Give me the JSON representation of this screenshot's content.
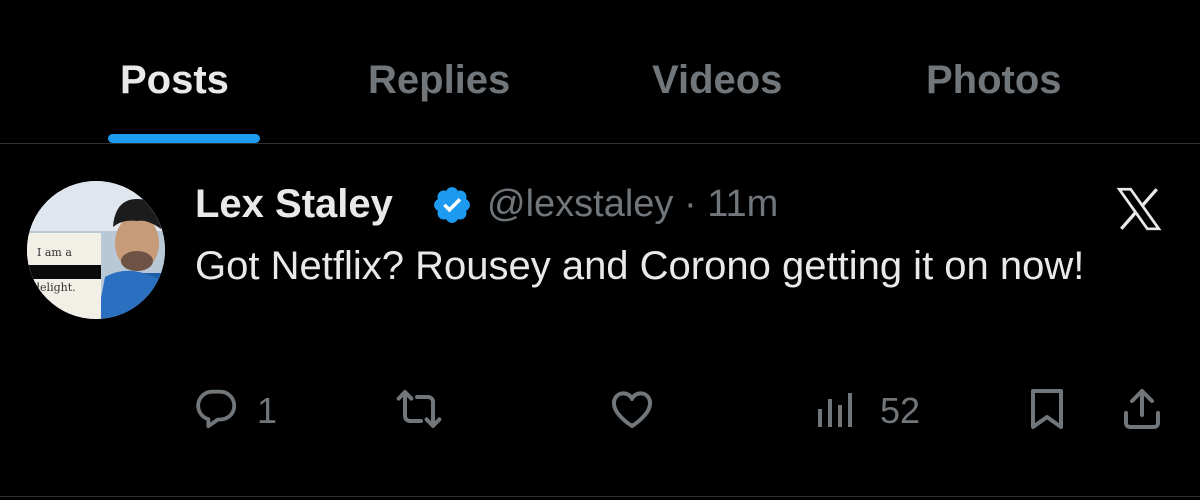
{
  "tabs": [
    {
      "label": "Posts",
      "active": true
    },
    {
      "label": "Replies",
      "active": false
    },
    {
      "label": "Videos",
      "active": false
    },
    {
      "label": "Photos",
      "active": false
    }
  ],
  "post": {
    "author_name": "Lex Staley",
    "verified": true,
    "handle": "@lexstaley",
    "separator": "·",
    "time": "11m",
    "text": "Got Netflix? Rousey and Corono getting it on now!",
    "avatar_mug_text": [
      "I am a",
      "delight."
    ],
    "actions": {
      "reply_count": "1",
      "repost_count": "",
      "like_count": "",
      "views_count": "52"
    }
  },
  "colors": {
    "background": "#000000",
    "primary_text": "#e7e9ea",
    "secondary_text": "#71767b",
    "accent": "#1d9bf0",
    "divider": "#2f3336"
  },
  "icons": [
    "verified-badge-icon",
    "x-logo-icon",
    "reply-icon",
    "repost-icon",
    "like-icon",
    "views-icon",
    "bookmark-icon",
    "share-icon"
  ]
}
